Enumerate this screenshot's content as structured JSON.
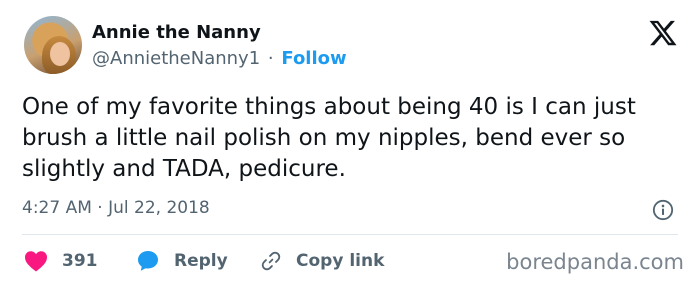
{
  "author": {
    "display_name": "Annie the Nanny",
    "handle": "@AnnietheNanny1",
    "separator": "·",
    "follow_label": "Follow"
  },
  "tweet": {
    "text": "One of my favorite things about being 40 is I can just brush a little nail polish on my nipples, bend ever so slightly and TADA, pedicure.",
    "timestamp": "4:27 AM · Jul 22, 2018"
  },
  "actions": {
    "like_count": "391",
    "reply_label": "Reply",
    "copy_link_label": "Copy link"
  },
  "watermark": "boredpanda.com",
  "icons": {
    "platform": "x-logo-icon",
    "info": "info-icon",
    "like": "heart-icon",
    "reply": "speech-bubble-icon",
    "copy_link": "link-icon"
  },
  "colors": {
    "accent": "#1d9bf0",
    "like": "#f91880",
    "text": "#0f1419",
    "secondary": "#536471"
  }
}
